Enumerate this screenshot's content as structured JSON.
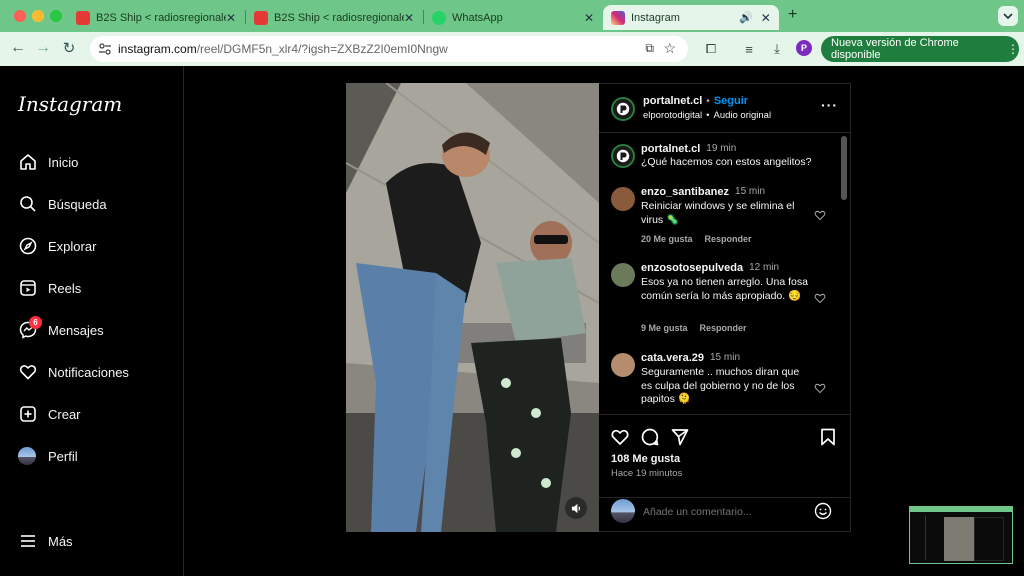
{
  "browser": {
    "tabs": [
      {
        "label": "B2S Ship < radiosregionales",
        "favicon": "radio-icon",
        "active": false
      },
      {
        "label": "B2S Ship < radiosregionales",
        "favicon": "radio-icon",
        "active": false
      },
      {
        "label": "WhatsApp",
        "favicon": "whatsapp-icon",
        "active": false
      },
      {
        "label": "Instagram",
        "favicon": "instagram-icon",
        "active": true
      }
    ],
    "new_tab": "+",
    "url_host": "instagram.com",
    "url_path": "/reel/DGMF5n_xlr4/?igsh=ZXBzZ2I0emI0Nngw",
    "profile_initial": "P",
    "update_label": "Nueva versión de Chrome disponible",
    "accent_color": "#6ec788"
  },
  "sidebar": {
    "logo": "Instagram",
    "items": [
      {
        "label": "Inicio",
        "icon": "home-icon"
      },
      {
        "label": "Búsqueda",
        "icon": "search-icon"
      },
      {
        "label": "Explorar",
        "icon": "compass-icon"
      },
      {
        "label": "Reels",
        "icon": "reels-icon"
      },
      {
        "label": "Mensajes",
        "icon": "messenger-icon",
        "badge": "6"
      },
      {
        "label": "Notificaciones",
        "icon": "heart-icon"
      },
      {
        "label": "Crear",
        "icon": "plus-square-icon"
      },
      {
        "label": "Perfil",
        "icon": "avatar"
      }
    ],
    "more_label": "Más"
  },
  "post": {
    "author": "portalnet.cl",
    "follow": "Seguir",
    "dot": "•",
    "audio_user": "elporotodigital",
    "audio_label": "Audio original",
    "caption_time": "19 min",
    "caption": "¿Qué hacemos con estos angelitos?",
    "comments": [
      {
        "user": "enzo_santibanez",
        "time": "15 min",
        "text": "Reiniciar windows y se elimina el virus 🦠",
        "likes": "20 Me gusta",
        "reply": "Responder"
      },
      {
        "user": "enzosotosepulveda",
        "time": "12 min",
        "text": "Esos ya no tienen arreglo. Una fosa común sería lo más apropiado. 😔",
        "likes": "9 Me gusta",
        "reply": "Responder"
      },
      {
        "user": "cata.vera.29",
        "time": "15 min",
        "text": "Seguramente .. muchos diran que es culpa del gobierno y no de los papitos 🫠",
        "likes": "",
        "reply": ""
      }
    ],
    "likes": "108 Me gusta",
    "posted": "Hace 19 minutos",
    "comment_placeholder": "Añade un comentario..."
  }
}
